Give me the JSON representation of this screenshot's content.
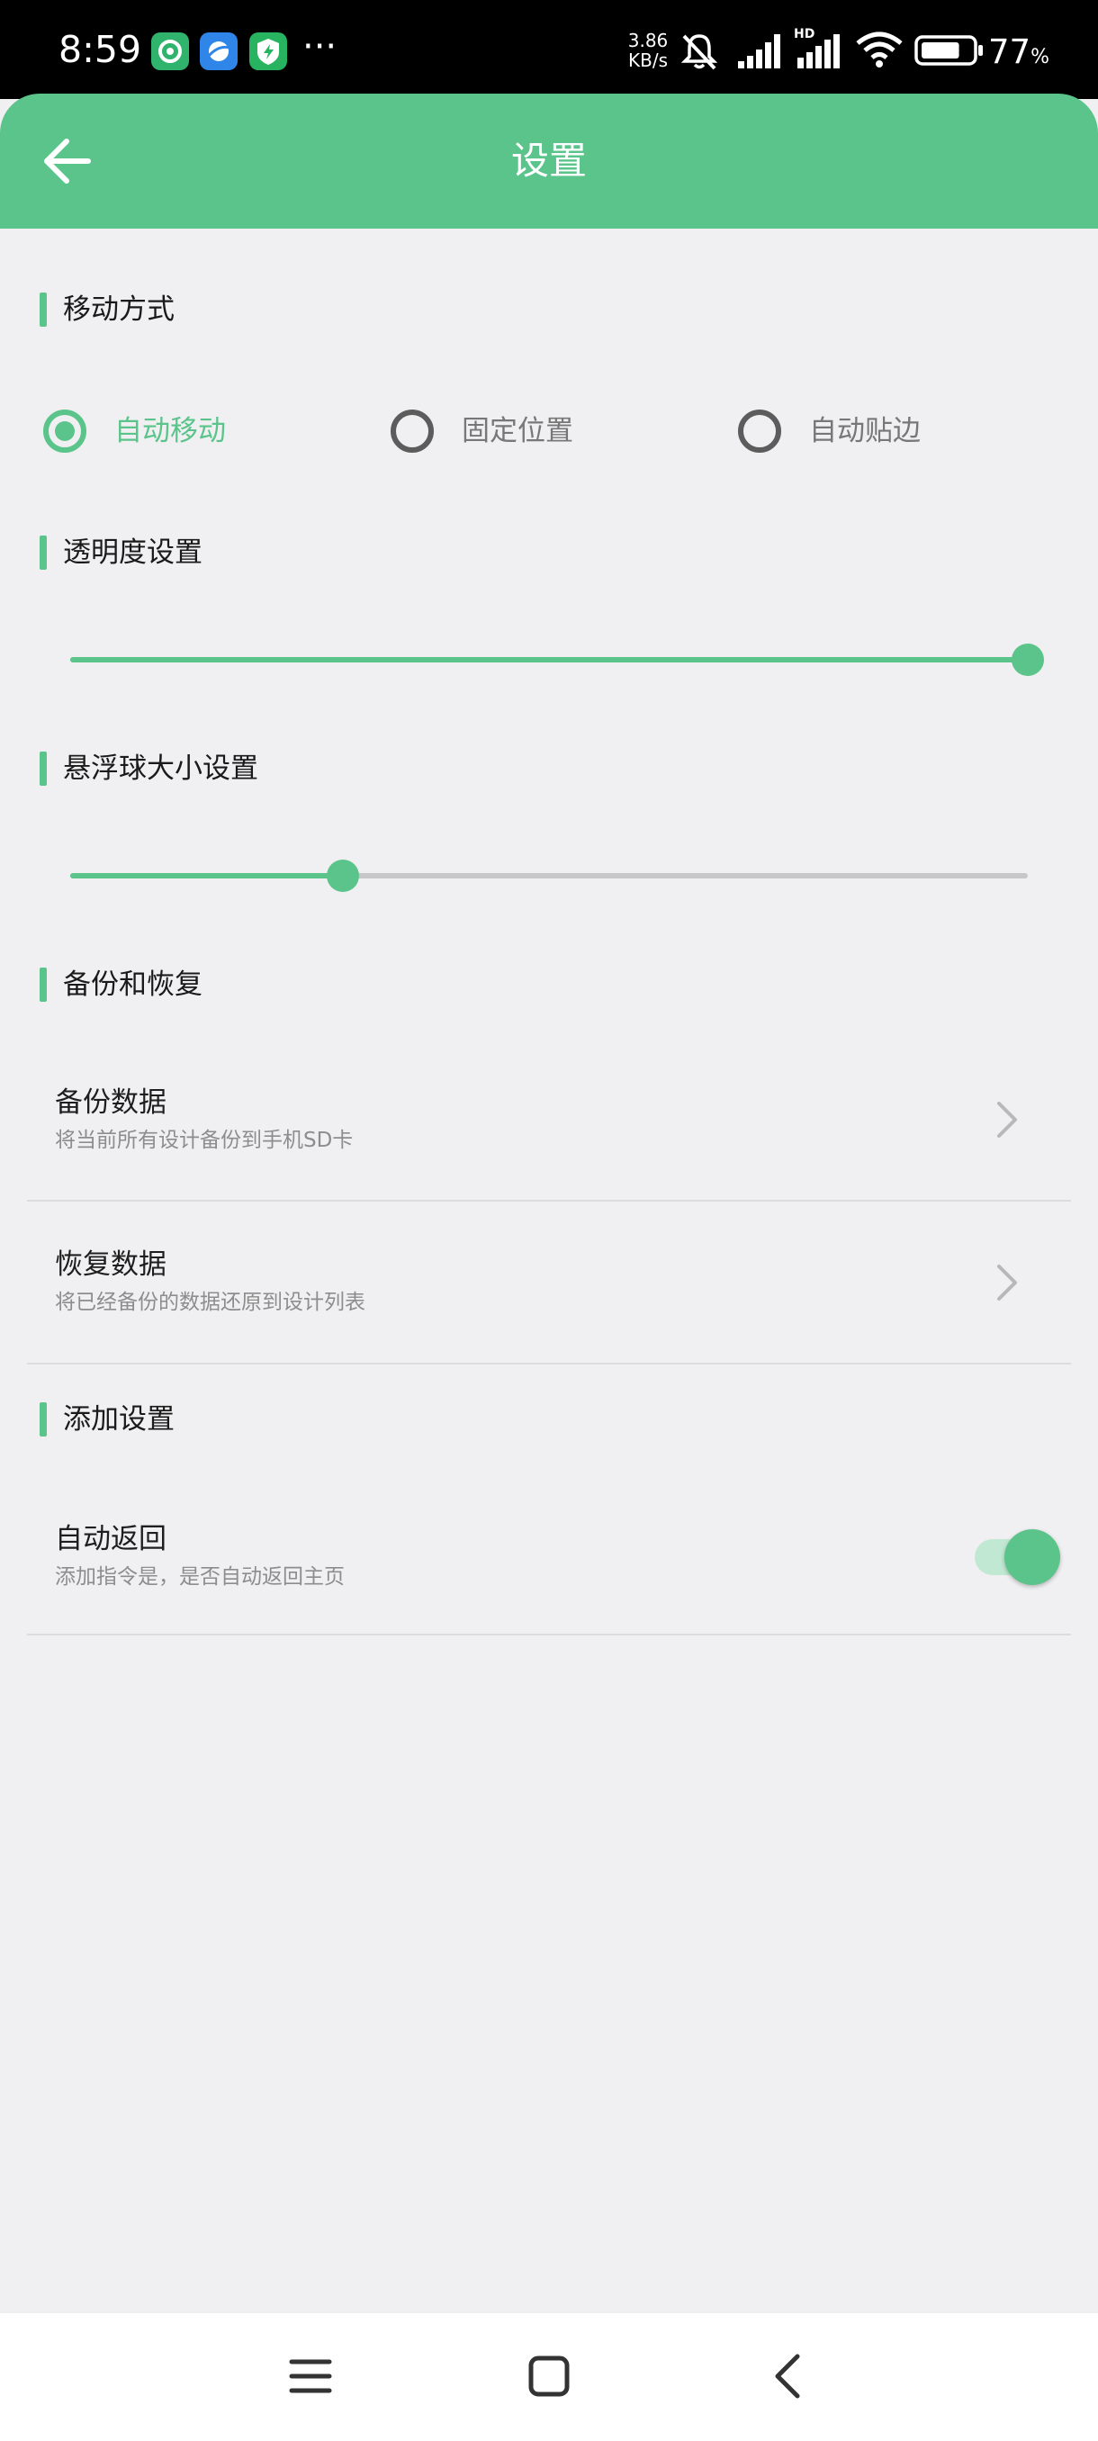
{
  "status_bar": {
    "time": "8:59",
    "more": "···",
    "net_speed_value": "3.86",
    "net_speed_unit": "KB/s",
    "hd": "HD",
    "battery_percent": "77",
    "battery_unit": "%",
    "battery_level": 0.77
  },
  "header": {
    "title": "设置",
    "back_icon": "arrow-left-icon"
  },
  "colors": {
    "accent": "#5bc48a",
    "background": "#f0f0f2"
  },
  "sections": {
    "move_mode": {
      "title": "移动方式",
      "options": [
        "自动移动",
        "固定位置",
        "自动贴边"
      ],
      "selected": "自动移动"
    },
    "opacity": {
      "title": "透明度设置",
      "value": 1.0
    },
    "ball_size": {
      "title": "悬浮球大小设置",
      "value": 0.285
    },
    "backup": {
      "title": "备份和恢复",
      "backup_title": "备份数据",
      "backup_sub": "将当前所有设计备份到手机SD卡",
      "restore_title": "恢复数据",
      "restore_sub": "将已经备份的数据还原到设计列表"
    },
    "add_settings": {
      "title": "添加设置",
      "auto_return_title": "自动返回",
      "auto_return_sub": "添加指令是，是否自动返回主页",
      "auto_return_on": true
    }
  },
  "nav_bar": {
    "menu_icon": "menu-icon",
    "home_icon": "home-square-icon",
    "back_icon": "back-chevron-icon"
  }
}
